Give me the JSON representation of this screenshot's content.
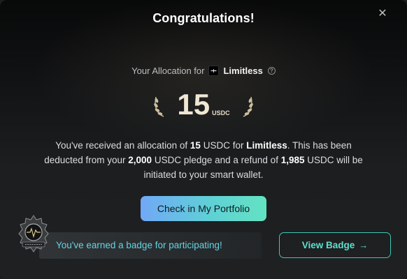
{
  "modal": {
    "title": "Congratulations!",
    "close_icon": "close-icon"
  },
  "allocation": {
    "label": "Your Allocation for",
    "project_name": "Limitless",
    "project_logo_icon": "limitless-logo-icon",
    "info_icon": "info-icon",
    "info_glyph": "?",
    "amount": "15",
    "unit": "USDC"
  },
  "description": {
    "p1": "You've received an allocation of ",
    "amount": "15",
    "p2": " USDC for ",
    "project": "Limitless",
    "p3": ". This has been deducted from your ",
    "pledge": "2,000",
    "p4": " USDC pledge and a refund of ",
    "refund": "1,985",
    "p5": " USDC will be initiated to your smart wallet."
  },
  "cta": {
    "label": "Check in My Portfolio"
  },
  "badge": {
    "message": "You've earned a badge for participating!",
    "button_label": "View Badge",
    "button_arrow": "→",
    "emblem_icon": "badge-emblem-icon"
  },
  "colors": {
    "accent_teal": "#5ee0cf",
    "gradient_start": "#71a8f6",
    "gradient_end": "#63e3c2",
    "gold": "#efe6d4"
  }
}
